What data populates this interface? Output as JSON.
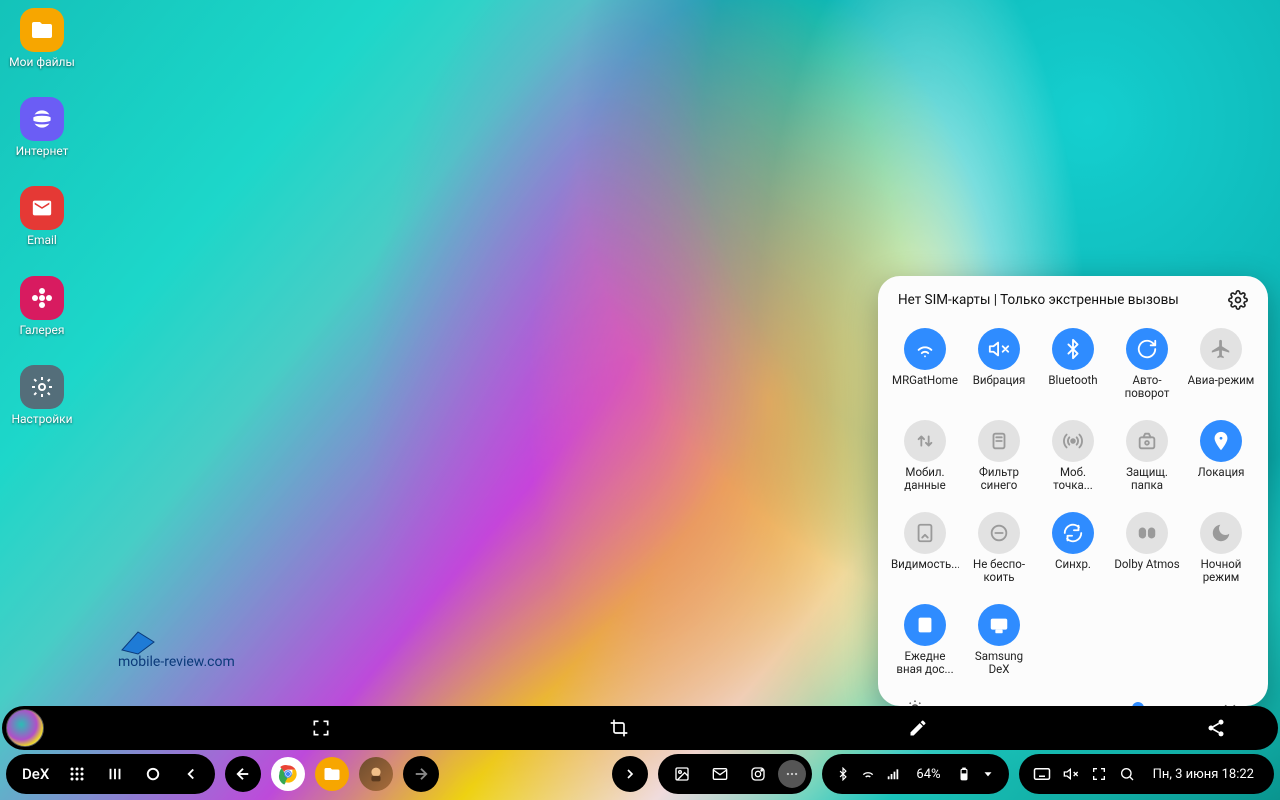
{
  "desktop_icons": [
    {
      "id": "files",
      "label": "Мои файлы",
      "bg": "#f7a600",
      "icon": "folder"
    },
    {
      "id": "internet",
      "label": "Интернет",
      "bg": "#6b5df5",
      "icon": "planet"
    },
    {
      "id": "email",
      "label": "Email",
      "bg": "#e53935",
      "icon": "mail"
    },
    {
      "id": "gallery",
      "label": "Галерея",
      "bg": "#d81b60",
      "icon": "flower"
    },
    {
      "id": "settings",
      "label": "Настройки",
      "bg": "#546e7a",
      "icon": "gear"
    }
  ],
  "watermark": "mobile-review.com",
  "quick_settings": {
    "header": "Нет SIM-карты | Только экстренные вызовы",
    "tiles": [
      {
        "id": "wifi",
        "label": "MRGatHome",
        "icon": "wifi",
        "on": true
      },
      {
        "id": "vibrate",
        "label": "Вибрация",
        "icon": "vibrate",
        "on": true
      },
      {
        "id": "bluetooth",
        "label": "Bluetooth",
        "icon": "bt",
        "on": true
      },
      {
        "id": "rotate",
        "label": "Авто-поворот",
        "icon": "rotate",
        "on": true
      },
      {
        "id": "airplane",
        "label": "Авиа-режим",
        "icon": "airplane",
        "on": false
      },
      {
        "id": "mobiledata",
        "label": "Мобил. данные",
        "icon": "data",
        "on": false
      },
      {
        "id": "bluefilter",
        "label": "Фильтр синего",
        "icon": "blue",
        "on": false
      },
      {
        "id": "hotspot",
        "label": "Моб. точка...",
        "icon": "hotspot",
        "on": false
      },
      {
        "id": "secfolder",
        "label": "Защищ. папка",
        "icon": "secure",
        "on": false
      },
      {
        "id": "location",
        "label": "Локация",
        "icon": "location",
        "on": true
      },
      {
        "id": "visibility",
        "label": "Видимость...",
        "icon": "vis",
        "on": false
      },
      {
        "id": "dnd",
        "label": "Не беспо-коить",
        "icon": "dnd",
        "on": false
      },
      {
        "id": "sync",
        "label": "Синхр.",
        "icon": "sync",
        "on": true
      },
      {
        "id": "dolby",
        "label": "Dolby Atmos",
        "icon": "dolby",
        "on": false
      },
      {
        "id": "night",
        "label": "Ночной режим",
        "icon": "night",
        "on": false
      },
      {
        "id": "briefing",
        "label": "Ежедне вная дос...",
        "icon": "briefing",
        "on": true
      },
      {
        "id": "dex",
        "label": "Samsung DeX",
        "icon": "dex",
        "on": true
      }
    ],
    "brightness_percent": 72
  },
  "taskbar": {
    "dex_label": "DeX",
    "battery_text": "64%",
    "datetime": "Пн, 3 июня 18:22"
  }
}
